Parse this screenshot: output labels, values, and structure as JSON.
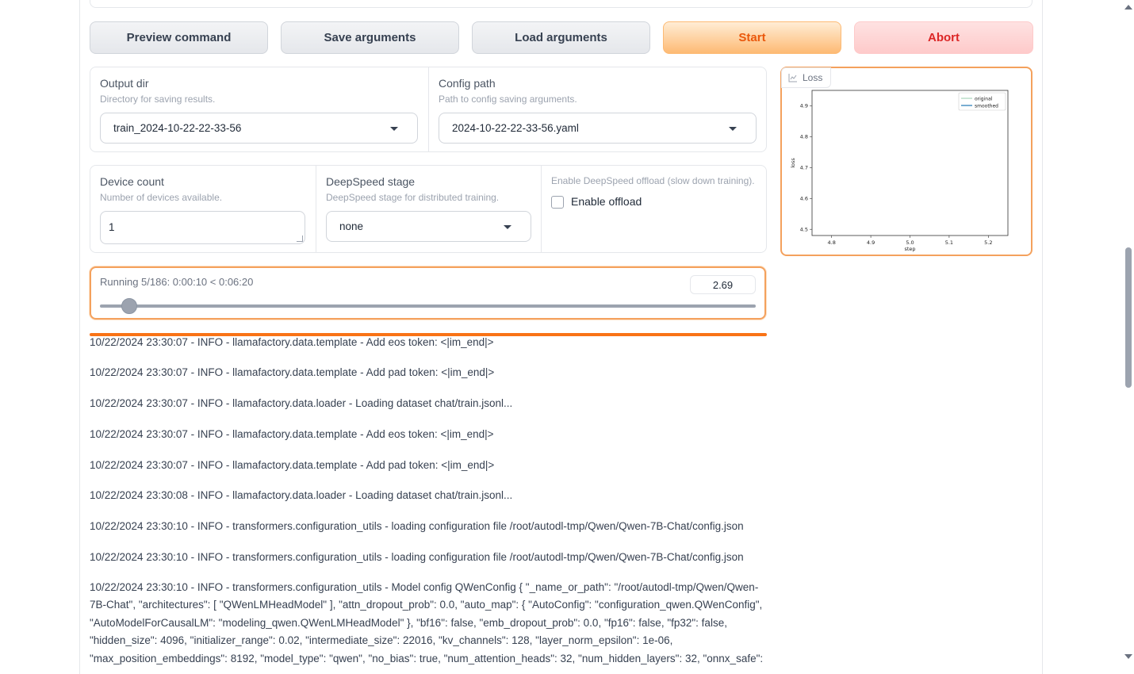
{
  "buttons": {
    "preview": "Preview command",
    "save": "Save arguments",
    "load": "Load arguments",
    "start": "Start",
    "abort": "Abort"
  },
  "output_dir": {
    "label": "Output dir",
    "info": "Directory for saving results.",
    "value": "train_2024-10-22-22-33-56"
  },
  "config_path": {
    "label": "Config path",
    "info": "Path to config saving arguments.",
    "value": "2024-10-22-22-33-56.yaml"
  },
  "device_count": {
    "label": "Device count",
    "info": "Number of devices available.",
    "value": "1"
  },
  "deepspeed_stage": {
    "label": "DeepSpeed stage",
    "info": "DeepSpeed stage for distributed training.",
    "value": "none"
  },
  "offload": {
    "info": "Enable DeepSpeed offload (slow down training).",
    "label": "Enable offload",
    "checked": false
  },
  "progress": {
    "label": "Running 5/186: 0:00:10 < 0:06:20",
    "value": "2.69",
    "fraction": 0.0269
  },
  "plot": {
    "tag": "Loss"
  },
  "chart_data": {
    "type": "line",
    "xlabel": "step",
    "ylabel": "loss",
    "xlim": [
      4.75,
      5.25
    ],
    "ylim": [
      4.48,
      4.95
    ],
    "x_ticks": [
      "4.8",
      "4.9",
      "5.0",
      "5.1",
      "5.2"
    ],
    "y_ticks": [
      "4.5",
      "4.6",
      "4.7",
      "4.8",
      "4.9"
    ],
    "legend_position": "top-right",
    "series": [
      {
        "name": "original",
        "color": "#a8d5ba",
        "x": [],
        "y": []
      },
      {
        "name": "smoothed",
        "color": "#1f77b4",
        "x": [],
        "y": []
      }
    ]
  },
  "log": {
    "lines": [
      "10/22/2024 23:30:07 - INFO - llamafactory.data.template - Add eos token: <|im_end|>",
      "10/22/2024 23:30:07 - INFO - llamafactory.data.template - Add pad token: <|im_end|>",
      "10/22/2024 23:30:07 - INFO - llamafactory.data.loader - Loading dataset chat/train.jsonl...",
      "10/22/2024 23:30:07 - INFO - llamafactory.data.template - Add eos token: <|im_end|>",
      "10/22/2024 23:30:07 - INFO - llamafactory.data.template - Add pad token: <|im_end|>",
      "10/22/2024 23:30:08 - INFO - llamafactory.data.loader - Loading dataset chat/train.jsonl...",
      "10/22/2024 23:30:10 - INFO - transformers.configuration_utils - loading configuration file /root/autodl-tmp/Qwen/Qwen-7B-Chat/config.json",
      "10/22/2024 23:30:10 - INFO - transformers.configuration_utils - loading configuration file /root/autodl-tmp/Qwen/Qwen-7B-Chat/config.json"
    ],
    "config_block": "10/22/2024 23:30:10 - INFO - transformers.configuration_utils - Model config QWenConfig { \"_name_or_path\": \"/root/autodl-tmp/Qwen/Qwen-7B-Chat\", \"architectures\": [ \"QWenLMHeadModel\" ], \"attn_dropout_prob\": 0.0, \"auto_map\": { \"AutoConfig\": \"configuration_qwen.QWenConfig\", \"AutoModelForCausalLM\": \"modeling_qwen.QWenLMHeadModel\" }, \"bf16\": false, \"emb_dropout_prob\": 0.0, \"fp16\": false, \"fp32\": false, \"hidden_size\": 4096, \"initializer_range\": 0.02, \"intermediate_size\": 22016, \"kv_channels\": 128, \"layer_norm_epsilon\": 1e-06, \"max_position_embeddings\": 8192, \"model_type\": \"qwen\", \"no_bias\": true, \"num_attention_heads\": 32, \"num_hidden_layers\": 32, \"onnx_safe\":"
  }
}
